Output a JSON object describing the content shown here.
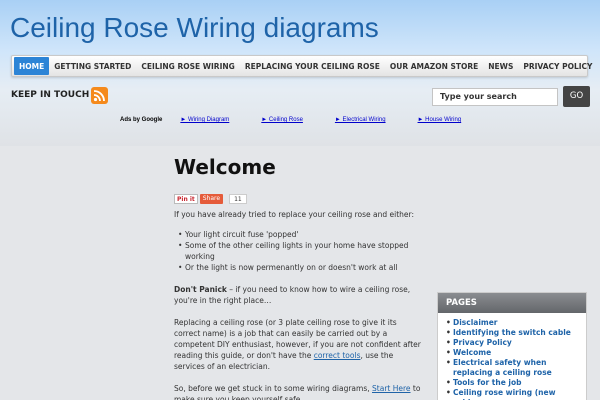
{
  "site": {
    "title": "Ceiling Rose Wiring diagrams"
  },
  "nav": {
    "items": [
      {
        "label": "HOME",
        "active": true
      },
      {
        "label": "GETTING STARTED",
        "active": false
      },
      {
        "label": "CEILING ROSE WIRING",
        "active": false
      },
      {
        "label": "REPLACING YOUR CEILING ROSE",
        "active": false
      },
      {
        "label": "OUR AMAZON STORE",
        "active": false
      },
      {
        "label": "NEWS",
        "active": false
      },
      {
        "label": "PRIVACY POLICY",
        "active": false
      }
    ]
  },
  "toolbar": {
    "keep_in_touch": "KEEP IN TOUCH",
    "rss_icon": "rss-icon",
    "search_placeholder": "Type your search",
    "go_label": "GO"
  },
  "ads": {
    "label": "Ads by Google",
    "links": [
      "► Wiring Diagram",
      "► Ceiling Rose",
      "► Electrical Wiring",
      "► House Wiring"
    ]
  },
  "main": {
    "heading": "Welcome",
    "share": {
      "pinit": "Pin it",
      "share": "Share",
      "count": "11"
    },
    "intro": "If you have already tried to replace your ceiling rose and either:",
    "bullets": [
      "Your light circuit fuse 'popped'",
      "Some of the other ceiling lights in your home have stopped working",
      "Or the light is now permenantly on or doesn't work at all"
    ],
    "dont_panic_bold": "Don't Panick",
    "dont_panic_rest": " – if you need to know how to wire a ceiling rose, you're in the right place…",
    "replacing_text": "Replacing a ceiling rose (or 3 plate ceiling rose to give it its correct name) is a job that can easily be carried out by a competent DIY enthusiast, however, if you are not confident after reading this guide, or don't have the ",
    "correct_tools_link": "correct tools",
    "replacing_tail": ", use the services of an electrician.",
    "before_text": "So, before we get stuck in to some wiring diagrams, ",
    "start_here_link": "Start Here",
    "before_tail": " to make sure you keep yourself safe."
  },
  "sidebar": {
    "pages_title": "PAGES",
    "pages": [
      "Disclaimer",
      "Identifying the switch cable",
      "Privacy Policy",
      "Welcome",
      "Electrical safety when replacing a ceiling rose",
      "Tools for the job",
      "Ceiling rose wiring (new cable"
    ]
  },
  "colors": {
    "accent": "#1e63a8",
    "nav_active": "#2c84d6",
    "rss": "#f58a1c"
  }
}
